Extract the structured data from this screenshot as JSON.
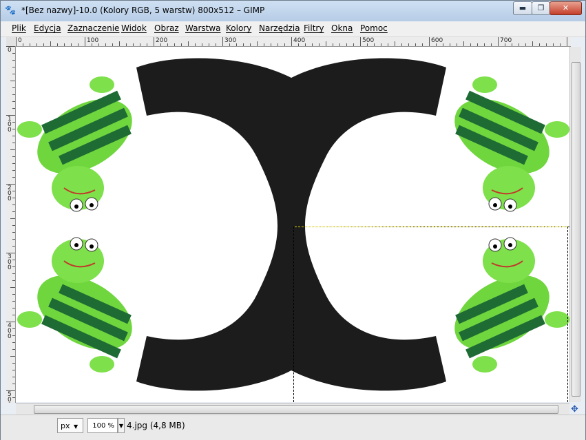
{
  "window": {
    "title": "*[Bez nazwy]-10.0 (Kolory RGB, 5 warstw) 800x512 – GIMP",
    "controls": {
      "minimize": "▬",
      "maximize": "❐",
      "close": "✕"
    }
  },
  "menu": {
    "items": [
      "Plik",
      "Edycja",
      "Zaznaczenie",
      "Widok",
      "Obraz",
      "Warstwa",
      "Kolory",
      "Narzędzia",
      "Filtry",
      "Okna",
      "Pomoc"
    ]
  },
  "ruler": {
    "h_labels": [
      "0",
      "100",
      "200",
      "300",
      "400",
      "500",
      "600",
      "700"
    ],
    "v_labels": [
      "0",
      "100",
      "200",
      "300",
      "400",
      "500"
    ]
  },
  "status": {
    "unit": "px",
    "zoom": "100 %",
    "file": "4.jpg (4,8 MB)"
  },
  "icons": {
    "title": "gimp-icon",
    "navigate": "navigate-icon"
  },
  "colors": {
    "frog_light": "#7ee04a",
    "frog_dark": "#1e6b34",
    "shape": "#1c1c1c"
  }
}
